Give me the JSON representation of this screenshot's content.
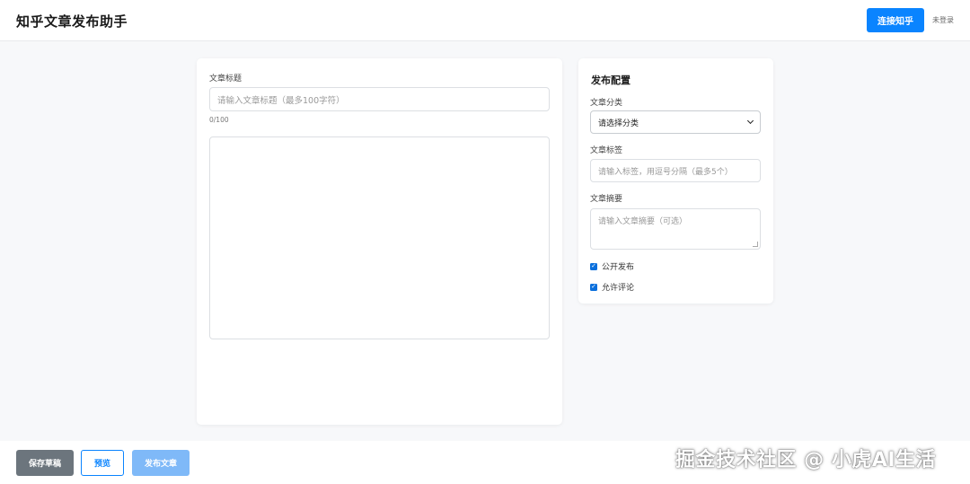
{
  "header": {
    "title": "知乎文章发布助手",
    "connect_label": "连接知乎",
    "login_status": "未登录"
  },
  "editor": {
    "title_label": "文章标题",
    "title_placeholder": "请输入文章标题（最多100字符）",
    "title_value": "",
    "char_counter": "0/100",
    "content_value": ""
  },
  "config": {
    "heading": "发布配置",
    "category_label": "文章分类",
    "category_selected": "请选择分类",
    "tags_label": "文章标签",
    "tags_placeholder": "请输入标签，用逗号分隔（最多5个）",
    "summary_label": "文章摘要",
    "summary_placeholder": "请输入文章摘要（可选）",
    "public_label": "公开发布",
    "public_checked": true,
    "comments_label": "允许评论",
    "comments_checked": true
  },
  "footer": {
    "save_draft_label": "保存草稿",
    "preview_label": "预览",
    "publish_label": "发布文章"
  },
  "watermark": "掘金技术社区 @ 小虎AI生活",
  "colors": {
    "primary": "#0a84ff",
    "primary_disabled": "#7fb9f8",
    "secondary": "#6c757d",
    "background": "#f7f8fa"
  }
}
